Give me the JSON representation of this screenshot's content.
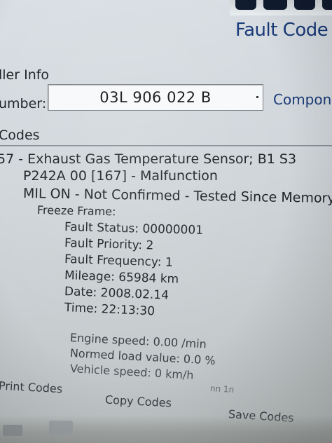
{
  "window": {
    "title": "Fault Code"
  },
  "header": {
    "controller_info": "ller Info",
    "number_label": "umber:",
    "part_number": "03L 906 022 B",
    "component_label": "Compon"
  },
  "codes": {
    "label": "Codes",
    "fault": {
      "line0": "57 - Exhaust Gas Temperature Sensor; B1 S3",
      "line1": "P242A 00 [167] - Malfunction",
      "line2": "MIL ON - Not Confirmed - Tested Since Memory",
      "freeze_frame": "Freeze Frame:",
      "fault_status": "Fault Status: 00000001",
      "fault_priority": "Fault Priority: 2",
      "fault_frequency": "Fault Frequency: 1",
      "mileage": "Mileage: 65984 km",
      "date": "Date: 2008.02.14",
      "time": "Time: 22:13:30",
      "engine_speed": "Engine speed: 0.00 /min",
      "normed_load": "Normed load value: 0.0 %",
      "vehicle_speed": "Vehicle speed: 0 km/h",
      "cut_line": "nn 1n"
    }
  },
  "buttons": {
    "print": "Print Codes",
    "copy": "Copy Codes",
    "save": "Save Codes"
  }
}
